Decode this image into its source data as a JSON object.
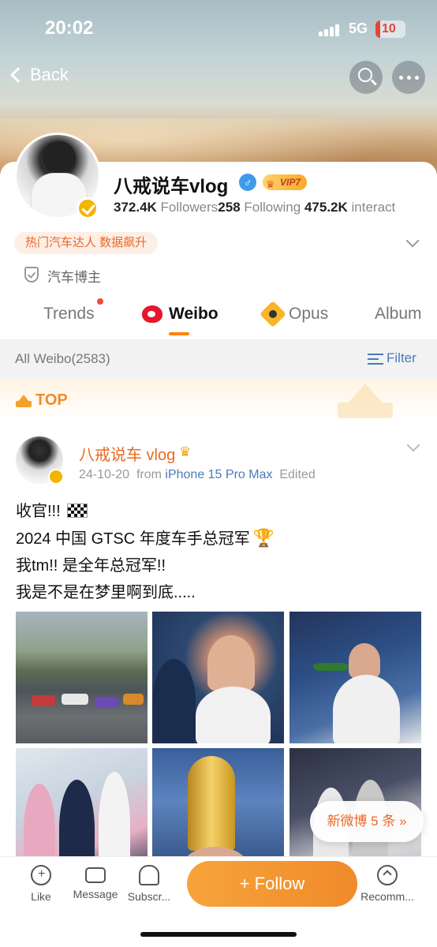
{
  "status_bar": {
    "time": "20:02",
    "network": "5G",
    "battery": "10",
    "battery_color": "#e8443a"
  },
  "nav": {
    "back_label": "Back"
  },
  "profile": {
    "name": "八戒说车vlog",
    "gender_symbol": "♂",
    "vip_label": "VIP7",
    "followers_count": "372.4K",
    "followers_label": " Followers",
    "following_count": "258",
    "following_label": " Following",
    "interact_count": "475.2K",
    "interact_label": " interact",
    "tag": "热门汽车达人 数据飙升",
    "certification": "汽车博主"
  },
  "tabs": [
    {
      "label": "Trends",
      "has_dot": true
    },
    {
      "label": "Weibo",
      "active": true
    },
    {
      "label": "Opus"
    },
    {
      "label": "Album"
    }
  ],
  "filter_bar": {
    "all_label": "All Weibo(2583)",
    "filter_label": "Filter"
  },
  "top_label": "TOP",
  "post": {
    "author": "八戒说车 vlog",
    "date": "24-10-20",
    "from_label": "from ",
    "source": "iPhone 15 Pro Max",
    "edited": "Edited",
    "lines": [
      "收官!!!",
      "2024 中国 GTSC 年度车手总冠军",
      "我tm!! 是全年总冠军!!",
      "我是不是在梦里啊到底....."
    ]
  },
  "new_posts": "新微博 5 条",
  "bottom_bar": {
    "like": "Like",
    "message": "Message",
    "subscribe": "Subscr...",
    "follow": "+ Follow",
    "recommend": "Recomm..."
  },
  "colors": {
    "accent": "#ff8200",
    "follow": "#f08a2a",
    "link": "#4a7ab8"
  }
}
